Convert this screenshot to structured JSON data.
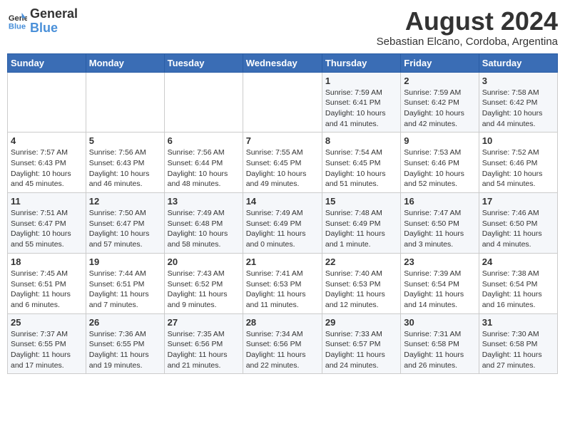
{
  "header": {
    "logo_line1": "General",
    "logo_line2": "Blue",
    "month_year": "August 2024",
    "location": "Sebastian Elcano, Cordoba, Argentina"
  },
  "weekdays": [
    "Sunday",
    "Monday",
    "Tuesday",
    "Wednesday",
    "Thursday",
    "Friday",
    "Saturday"
  ],
  "weeks": [
    [
      {
        "day": "",
        "info": ""
      },
      {
        "day": "",
        "info": ""
      },
      {
        "day": "",
        "info": ""
      },
      {
        "day": "",
        "info": ""
      },
      {
        "day": "1",
        "info": "Sunrise: 7:59 AM\nSunset: 6:41 PM\nDaylight: 10 hours and 41 minutes."
      },
      {
        "day": "2",
        "info": "Sunrise: 7:59 AM\nSunset: 6:42 PM\nDaylight: 10 hours and 42 minutes."
      },
      {
        "day": "3",
        "info": "Sunrise: 7:58 AM\nSunset: 6:42 PM\nDaylight: 10 hours and 44 minutes."
      }
    ],
    [
      {
        "day": "4",
        "info": "Sunrise: 7:57 AM\nSunset: 6:43 PM\nDaylight: 10 hours and 45 minutes."
      },
      {
        "day": "5",
        "info": "Sunrise: 7:56 AM\nSunset: 6:43 PM\nDaylight: 10 hours and 46 minutes."
      },
      {
        "day": "6",
        "info": "Sunrise: 7:56 AM\nSunset: 6:44 PM\nDaylight: 10 hours and 48 minutes."
      },
      {
        "day": "7",
        "info": "Sunrise: 7:55 AM\nSunset: 6:45 PM\nDaylight: 10 hours and 49 minutes."
      },
      {
        "day": "8",
        "info": "Sunrise: 7:54 AM\nSunset: 6:45 PM\nDaylight: 10 hours and 51 minutes."
      },
      {
        "day": "9",
        "info": "Sunrise: 7:53 AM\nSunset: 6:46 PM\nDaylight: 10 hours and 52 minutes."
      },
      {
        "day": "10",
        "info": "Sunrise: 7:52 AM\nSunset: 6:46 PM\nDaylight: 10 hours and 54 minutes."
      }
    ],
    [
      {
        "day": "11",
        "info": "Sunrise: 7:51 AM\nSunset: 6:47 PM\nDaylight: 10 hours and 55 minutes."
      },
      {
        "day": "12",
        "info": "Sunrise: 7:50 AM\nSunset: 6:47 PM\nDaylight: 10 hours and 57 minutes."
      },
      {
        "day": "13",
        "info": "Sunrise: 7:49 AM\nSunset: 6:48 PM\nDaylight: 10 hours and 58 minutes."
      },
      {
        "day": "14",
        "info": "Sunrise: 7:49 AM\nSunset: 6:49 PM\nDaylight: 11 hours and 0 minutes."
      },
      {
        "day": "15",
        "info": "Sunrise: 7:48 AM\nSunset: 6:49 PM\nDaylight: 11 hours and 1 minute."
      },
      {
        "day": "16",
        "info": "Sunrise: 7:47 AM\nSunset: 6:50 PM\nDaylight: 11 hours and 3 minutes."
      },
      {
        "day": "17",
        "info": "Sunrise: 7:46 AM\nSunset: 6:50 PM\nDaylight: 11 hours and 4 minutes."
      }
    ],
    [
      {
        "day": "18",
        "info": "Sunrise: 7:45 AM\nSunset: 6:51 PM\nDaylight: 11 hours and 6 minutes."
      },
      {
        "day": "19",
        "info": "Sunrise: 7:44 AM\nSunset: 6:51 PM\nDaylight: 11 hours and 7 minutes."
      },
      {
        "day": "20",
        "info": "Sunrise: 7:43 AM\nSunset: 6:52 PM\nDaylight: 11 hours and 9 minutes."
      },
      {
        "day": "21",
        "info": "Sunrise: 7:41 AM\nSunset: 6:53 PM\nDaylight: 11 hours and 11 minutes."
      },
      {
        "day": "22",
        "info": "Sunrise: 7:40 AM\nSunset: 6:53 PM\nDaylight: 11 hours and 12 minutes."
      },
      {
        "day": "23",
        "info": "Sunrise: 7:39 AM\nSunset: 6:54 PM\nDaylight: 11 hours and 14 minutes."
      },
      {
        "day": "24",
        "info": "Sunrise: 7:38 AM\nSunset: 6:54 PM\nDaylight: 11 hours and 16 minutes."
      }
    ],
    [
      {
        "day": "25",
        "info": "Sunrise: 7:37 AM\nSunset: 6:55 PM\nDaylight: 11 hours and 17 minutes."
      },
      {
        "day": "26",
        "info": "Sunrise: 7:36 AM\nSunset: 6:55 PM\nDaylight: 11 hours and 19 minutes."
      },
      {
        "day": "27",
        "info": "Sunrise: 7:35 AM\nSunset: 6:56 PM\nDaylight: 11 hours and 21 minutes."
      },
      {
        "day": "28",
        "info": "Sunrise: 7:34 AM\nSunset: 6:56 PM\nDaylight: 11 hours and 22 minutes."
      },
      {
        "day": "29",
        "info": "Sunrise: 7:33 AM\nSunset: 6:57 PM\nDaylight: 11 hours and 24 minutes."
      },
      {
        "day": "30",
        "info": "Sunrise: 7:31 AM\nSunset: 6:58 PM\nDaylight: 11 hours and 26 minutes."
      },
      {
        "day": "31",
        "info": "Sunrise: 7:30 AM\nSunset: 6:58 PM\nDaylight: 11 hours and 27 minutes."
      }
    ]
  ]
}
